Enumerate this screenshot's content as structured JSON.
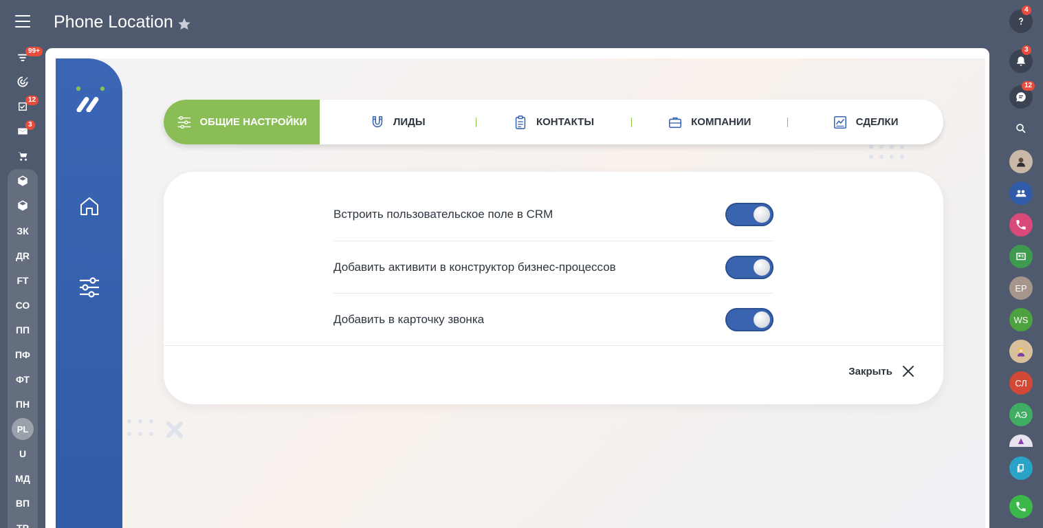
{
  "title": "Phone Location",
  "left_rail": {
    "badges": {
      "filter": "99+",
      "tasks": "12",
      "mail": "3"
    },
    "items": [
      "ЗК",
      "ДR",
      "FT",
      "СО",
      "ПП",
      "ПФ",
      "ФТ",
      "ПН",
      "PL",
      "U",
      "МД",
      "ВП",
      "ТР"
    ]
  },
  "right_rail": {
    "badges": {
      "help": "4",
      "notifications": "3",
      "chat": "12"
    },
    "avatars": [
      "ЕР",
      "WS",
      "СЛ",
      "АЭ"
    ]
  },
  "tabs": [
    {
      "label": "ОБЩИЕ НАСТРОЙКИ",
      "icon": "sliders-icon",
      "active": true
    },
    {
      "label": "ЛИДЫ",
      "icon": "magnet-icon"
    },
    {
      "label": "КОНТАКТЫ",
      "icon": "clipboard-icon"
    },
    {
      "label": "КОМПАНИИ",
      "icon": "briefcase-icon"
    },
    {
      "label": "СДЕЛКИ",
      "icon": "chart-icon"
    }
  ],
  "settings": [
    {
      "label": "Встроить пользовательское поле в CRM",
      "enabled": true
    },
    {
      "label": "Добавить активити в конструктор бизнес-процессов",
      "enabled": true
    },
    {
      "label": "Добавить в карточку звонка",
      "enabled": true
    }
  ],
  "close_label": "Закрыть",
  "colors": {
    "accent_green": "#8bbd57",
    "sidebar_blue": "#3b66b5",
    "toggle_blue": "#3a64b0"
  }
}
